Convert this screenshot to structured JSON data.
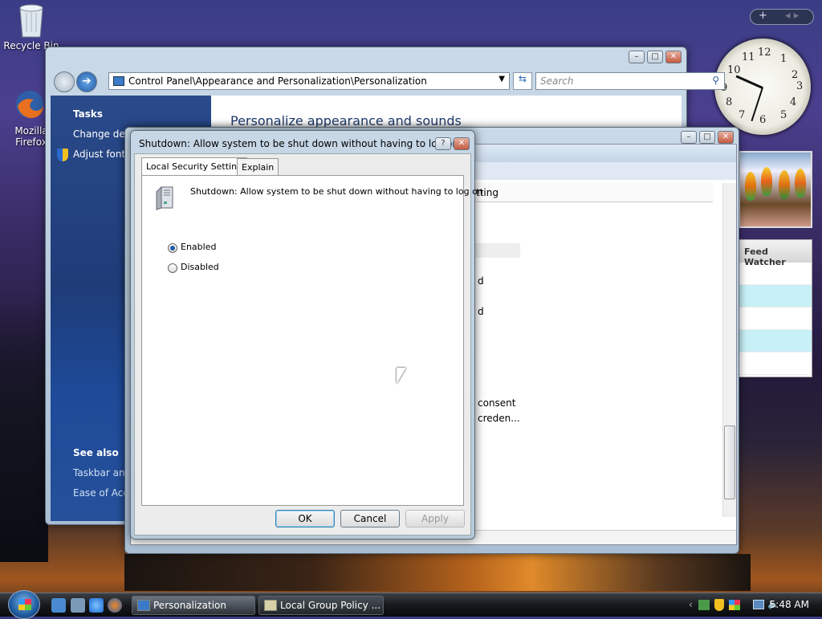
{
  "desktop": {
    "icons": [
      {
        "label": "Recycle Bin",
        "icon": "recycle-bin-icon"
      },
      {
        "label": "Mozilla Firefox",
        "icon": "firefox-icon"
      }
    ]
  },
  "sidebar": {
    "clock_numbers": [
      "12",
      "1",
      "2",
      "3",
      "4",
      "5",
      "6",
      "7",
      "8",
      "9",
      "10",
      "11"
    ],
    "feed_title": "Feed Watcher"
  },
  "personalization": {
    "address": "Control Panel\\Appearance and Personalization\\Personalization",
    "search_placeholder": "Search",
    "tasks_title": "Tasks",
    "tasks": [
      "Change des",
      "Adjust font"
    ],
    "see_also_title": "See also",
    "see_also": [
      "Taskbar and",
      "Ease of Acc"
    ],
    "heading": "Personalize appearance and sounds"
  },
  "group_policy": {
    "column_header": "tting",
    "rows": [
      "d",
      "d",
      "consent",
      "creden..."
    ]
  },
  "dialog": {
    "title": "Shutdown: Allow system to be shut down without having to log on...",
    "tabs": [
      "Local Security Setting",
      "Explain"
    ],
    "policy_name": "Shutdown: Allow system to be shut down without having to log on",
    "options": [
      {
        "label": "Enabled",
        "selected": true
      },
      {
        "label": "Disabled",
        "selected": false
      }
    ],
    "buttons": {
      "ok": "OK",
      "cancel": "Cancel",
      "apply": "Apply"
    }
  },
  "taskbar": {
    "tasks": [
      "Personalization",
      "Local Group Policy ..."
    ],
    "time": "5:48 AM"
  }
}
